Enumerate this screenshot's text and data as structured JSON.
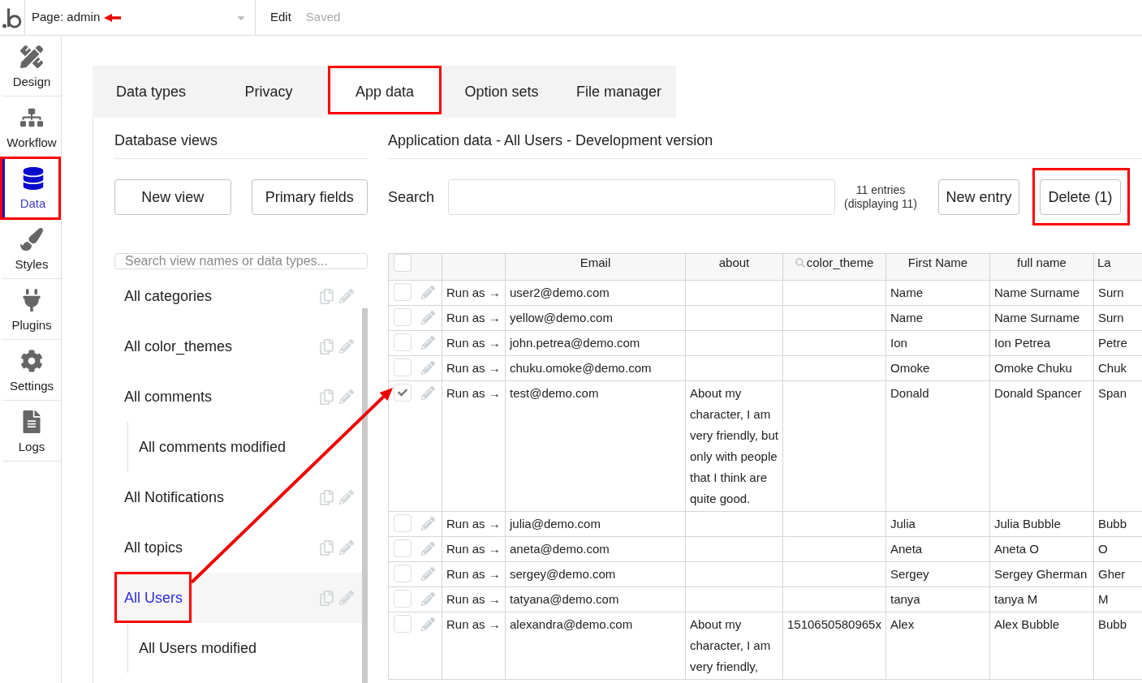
{
  "top_bar": {
    "page_selector": {
      "label": "Page: admin",
      "highlighted": true
    },
    "actions": [
      {
        "label": "Edit",
        "kind": "link"
      },
      {
        "label": "Saved",
        "kind": "status"
      }
    ]
  },
  "sidebar": {
    "items": [
      {
        "label": "Design",
        "selected": false,
        "highlighted": false
      },
      {
        "label": "Workflow",
        "selected": false,
        "highlighted": false
      },
      {
        "label": "Data",
        "selected": true,
        "highlighted": true
      },
      {
        "label": "Styles",
        "selected": false,
        "highlighted": false
      },
      {
        "label": "Plugins",
        "selected": false,
        "highlighted": false
      },
      {
        "label": "Settings",
        "selected": false,
        "highlighted": false
      },
      {
        "label": "Logs",
        "selected": false,
        "highlighted": false
      }
    ]
  },
  "tabs": [
    {
      "label": "Data types",
      "selected": false,
      "highlighted": false
    },
    {
      "label": "Privacy",
      "selected": false,
      "highlighted": false
    },
    {
      "label": "App data",
      "selected": true,
      "highlighted": true
    },
    {
      "label": "Option sets",
      "selected": false,
      "highlighted": false
    },
    {
      "label": "File manager",
      "selected": false,
      "highlighted": false
    }
  ],
  "views_panel": {
    "title": "Database views",
    "buttons": [
      "New view",
      "Primary fields"
    ],
    "search": {
      "placeholder": "Search view names or data types..."
    },
    "items": [
      {
        "label": "All categories",
        "selected": false,
        "highlighted": false
      },
      {
        "label": "All color_themes",
        "selected": false,
        "highlighted": false
      },
      {
        "label": "All comments",
        "selected": false,
        "highlighted": false,
        "children": [
          {
            "label": "All comments modified",
            "selected": false,
            "highlighted": false
          }
        ]
      },
      {
        "label": "All Notifications",
        "selected": false,
        "highlighted": false
      },
      {
        "label": "All topics",
        "selected": false,
        "highlighted": false
      },
      {
        "label": "All Users",
        "selected": true,
        "highlighted": true,
        "children": [
          {
            "label": "All Users modified",
            "selected": false,
            "highlighted": false
          }
        ]
      }
    ]
  },
  "data_panel": {
    "title": "Application data - All Users - Development version",
    "search": {
      "label": "Search"
    },
    "count": {
      "total": "11 entries",
      "displaying": "(displaying 11)"
    },
    "buttons": [
      {
        "label": "New entry",
        "highlighted": false
      },
      {
        "label": "Delete (1)",
        "highlighted": true
      }
    ]
  },
  "table": {
    "select_all": {
      "checked": false
    },
    "columns": [
      {
        "label": "Email",
        "kind": "plain"
      },
      {
        "label": "about",
        "kind": "plain"
      },
      {
        "label": "color_theme",
        "kind": "search"
      },
      {
        "label": "First Name",
        "kind": "plain"
      },
      {
        "label": "full name",
        "kind": "plain"
      },
      {
        "label": "La",
        "kind": "plain"
      }
    ],
    "rows": [
      {
        "checked": false,
        "action": "Run as →",
        "cells": [
          "user2@demo.com",
          null,
          null,
          "Name",
          "Name Surname",
          "Surn"
        ]
      },
      {
        "checked": false,
        "action": "Run as →",
        "cells": [
          "yellow@demo.com",
          null,
          null,
          "Name",
          "Name Surname",
          "Surn"
        ]
      },
      {
        "checked": false,
        "action": "Run as →",
        "cells": [
          "john.petrea@demo.com",
          null,
          null,
          "Ion",
          "Ion Petrea",
          "Petre"
        ]
      },
      {
        "checked": false,
        "action": "Run as →",
        "cells": [
          "chuku.omoke@demo.com",
          null,
          null,
          "Omoke",
          "Omoke Chuku",
          "Chuk"
        ]
      },
      {
        "checked": true,
        "action": "Run as →",
        "cells": [
          "test@demo.com",
          "About my character, I am very friendly, but only with people that I think are quite good.",
          null,
          "Donald",
          "Donald Spancer",
          "Span"
        ]
      },
      {
        "checked": false,
        "action": "Run as →",
        "cells": [
          "julia@demo.com",
          null,
          null,
          "Julia",
          "Julia Bubble",
          "Bubb"
        ]
      },
      {
        "checked": false,
        "action": "Run as →",
        "cells": [
          "aneta@demo.com",
          null,
          null,
          "Aneta",
          "Aneta O",
          "O"
        ]
      },
      {
        "checked": false,
        "action": "Run as →",
        "cells": [
          "sergey@demo.com",
          null,
          null,
          "Sergey",
          "Sergey Gherman",
          "Gher"
        ]
      },
      {
        "checked": false,
        "action": "Run as →",
        "cells": [
          "tatyana@demo.com",
          null,
          null,
          "tanya",
          "tanya M",
          "M"
        ]
      },
      {
        "checked": false,
        "action": "Run as →",
        "cells": [
          "alexandra@demo.com",
          "About my character, I am very friendly,",
          "1510650580965x",
          "Alex",
          "Alex Bubble",
          "Bubb"
        ]
      }
    ]
  }
}
